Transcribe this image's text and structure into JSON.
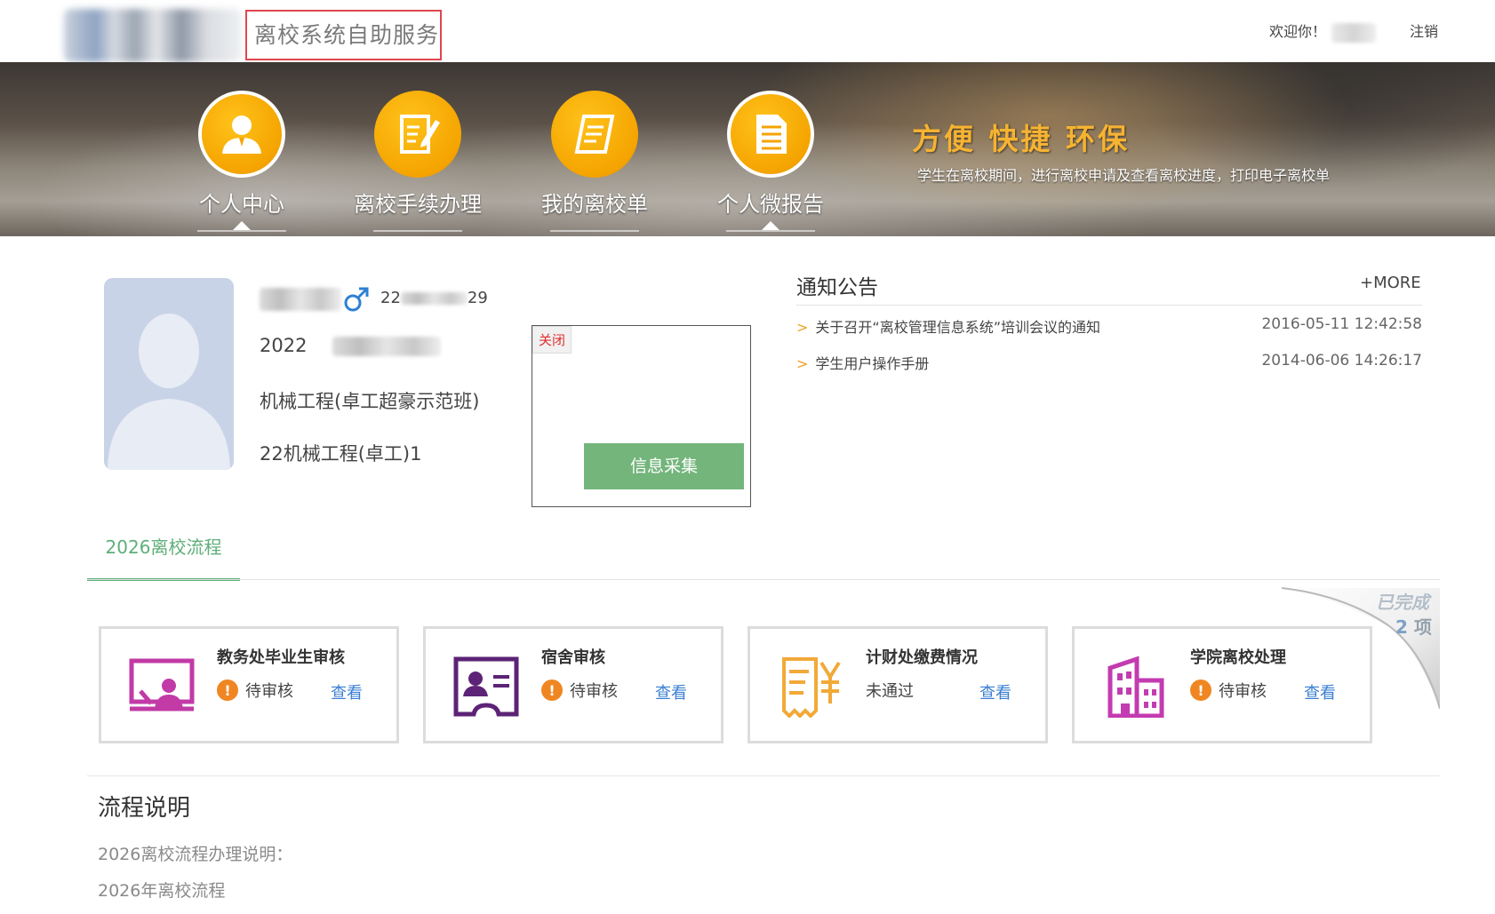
{
  "header": {
    "system_title": "离校系统自助服务",
    "welcome": "欢迎你！",
    "logout": "注销"
  },
  "nav": {
    "items": [
      {
        "label": "个人中心",
        "icon": "user-icon"
      },
      {
        "label": "离校手续办理",
        "icon": "edit-document-icon"
      },
      {
        "label": "我的离校单",
        "icon": "scroll-icon"
      },
      {
        "label": "个人微报告",
        "icon": "report-icon"
      }
    ],
    "active_index": 0
  },
  "banner": {
    "slogan": "方便 快捷 环保",
    "subtitle": "学生在离校期间，进行离校申请及查看离校进度，打印电子离校单"
  },
  "profile": {
    "id_prefix": "22",
    "id_suffix": "29",
    "year": "2022",
    "major": "机械工程(卓工超豪示范班)",
    "class": "22机械工程(卓工)1",
    "gender_icon": "male-icon"
  },
  "popup": {
    "close": "关闭",
    "button": "信息采集"
  },
  "notices": {
    "title": "通知公告",
    "more": "+MORE",
    "items": [
      {
        "title": "关于召开“离校管理信息系统”培训会议的通知",
        "date": "2016-05-11 12:42:58"
      },
      {
        "title": "学生用户操作手册",
        "date": "2014-06-06 14:26:17"
      }
    ],
    "arrow": ">"
  },
  "tabs": {
    "active": "2026离校流程"
  },
  "process": {
    "cards": [
      {
        "title": "教务处毕业生审核",
        "status": "待审核",
        "link": "查看",
        "has_warning": true,
        "icon": "presentation-icon",
        "color": "#c23aa6"
      },
      {
        "title": "宿舍审核",
        "status": "待审核",
        "link": "查看",
        "has_warning": true,
        "icon": "id-card-icon",
        "color": "#5c2376"
      },
      {
        "title": "计财处缴费情况",
        "status": "未通过",
        "link": "查看",
        "has_warning": false,
        "icon": "receipt-icon",
        "color": "#f2a938"
      },
      {
        "title": "学院离校处理",
        "status": "待审核",
        "link": "查看",
        "has_warning": true,
        "icon": "building-icon",
        "color": "#c33bb1"
      }
    ],
    "completed_label": "已完成",
    "completed_count": "2",
    "completed_unit": "项"
  },
  "explain": {
    "title": "流程说明",
    "line1": "2026离校流程办理说明：",
    "line2": "2026年离校流程"
  }
}
